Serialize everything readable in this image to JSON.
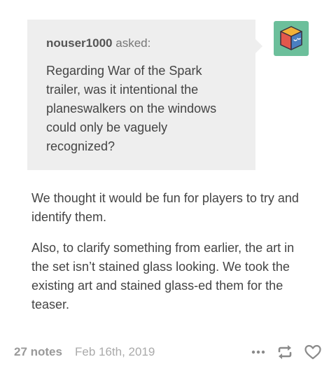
{
  "ask": {
    "asker": "nouser1000",
    "asked_label": "asked:",
    "question": "Regarding War of the Spark trailer, was it intentional the planeswalkers on the windows could only be vaguely recognized?"
  },
  "answer": {
    "paragraphs": [
      "We thought it would be fun for players to try and identify them.",
      "Also, to clarify something from earlier, the art in the set isn’t stained glass looking. We took the existing art and stained glass-ed them for the teaser."
    ]
  },
  "footer": {
    "notes": "27 notes",
    "date": "Feb 16th, 2019",
    "icons": [
      "more-icon",
      "reblog-icon",
      "heart-icon"
    ]
  },
  "colors": {
    "ask_background": "#eeeeee",
    "avatar_background": "#6cbf9b",
    "text": "#444444",
    "muted": "#999999"
  }
}
